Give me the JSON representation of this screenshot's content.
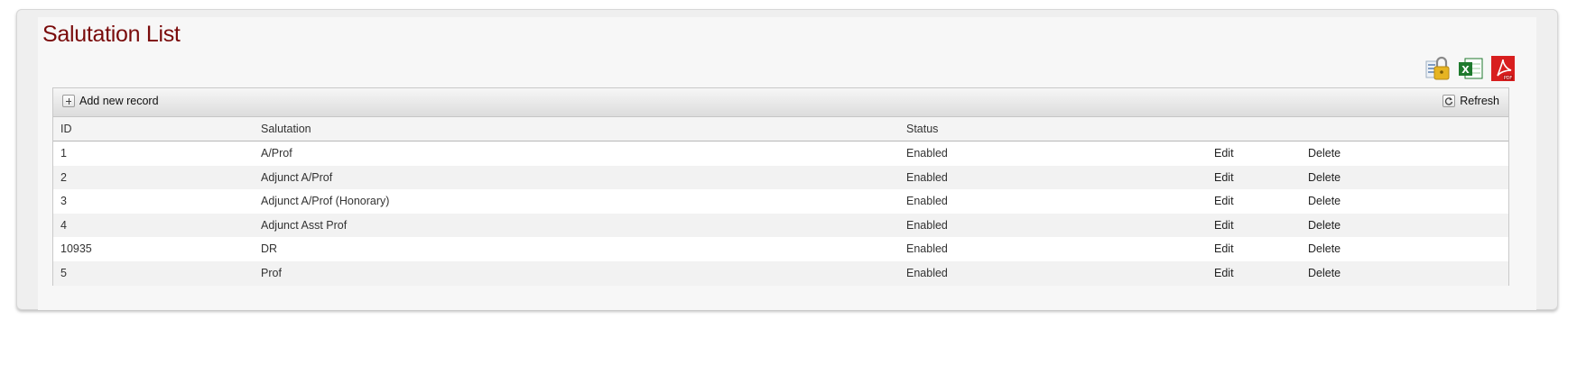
{
  "page": {
    "title": "Salutation List"
  },
  "exports": [
    {
      "icon": "security-lock-icon",
      "label": ""
    },
    {
      "icon": "excel-icon",
      "label": ""
    },
    {
      "icon": "pdf-icon",
      "label": ""
    }
  ],
  "toolbar": {
    "add_label": "Add new record",
    "refresh_label": "Refresh"
  },
  "columns": {
    "id": "ID",
    "salutation": "Salutation",
    "status": "Status"
  },
  "rows": [
    {
      "id": "1",
      "salutation": "A/Prof",
      "status": "Enabled",
      "edit": "Edit",
      "delete": "Delete"
    },
    {
      "id": "2",
      "salutation": "Adjunct A/Prof",
      "status": "Enabled",
      "edit": "Edit",
      "delete": "Delete"
    },
    {
      "id": "3",
      "salutation": "Adjunct A/Prof (Honorary)",
      "status": "Enabled",
      "edit": "Edit",
      "delete": "Delete"
    },
    {
      "id": "4",
      "salutation": "Adjunct Asst Prof",
      "status": "Enabled",
      "edit": "Edit",
      "delete": "Delete"
    },
    {
      "id": "10935",
      "salutation": "DR",
      "status": "Enabled",
      "edit": "Edit",
      "delete": "Delete"
    },
    {
      "id": "5",
      "salutation": "Prof",
      "status": "Enabled",
      "edit": "Edit",
      "delete": "Delete"
    }
  ],
  "colors": {
    "title": "#7a0b0b",
    "excel": "#1f7a2e",
    "pdf": "#d81e1e",
    "lock": "#e6b422"
  }
}
